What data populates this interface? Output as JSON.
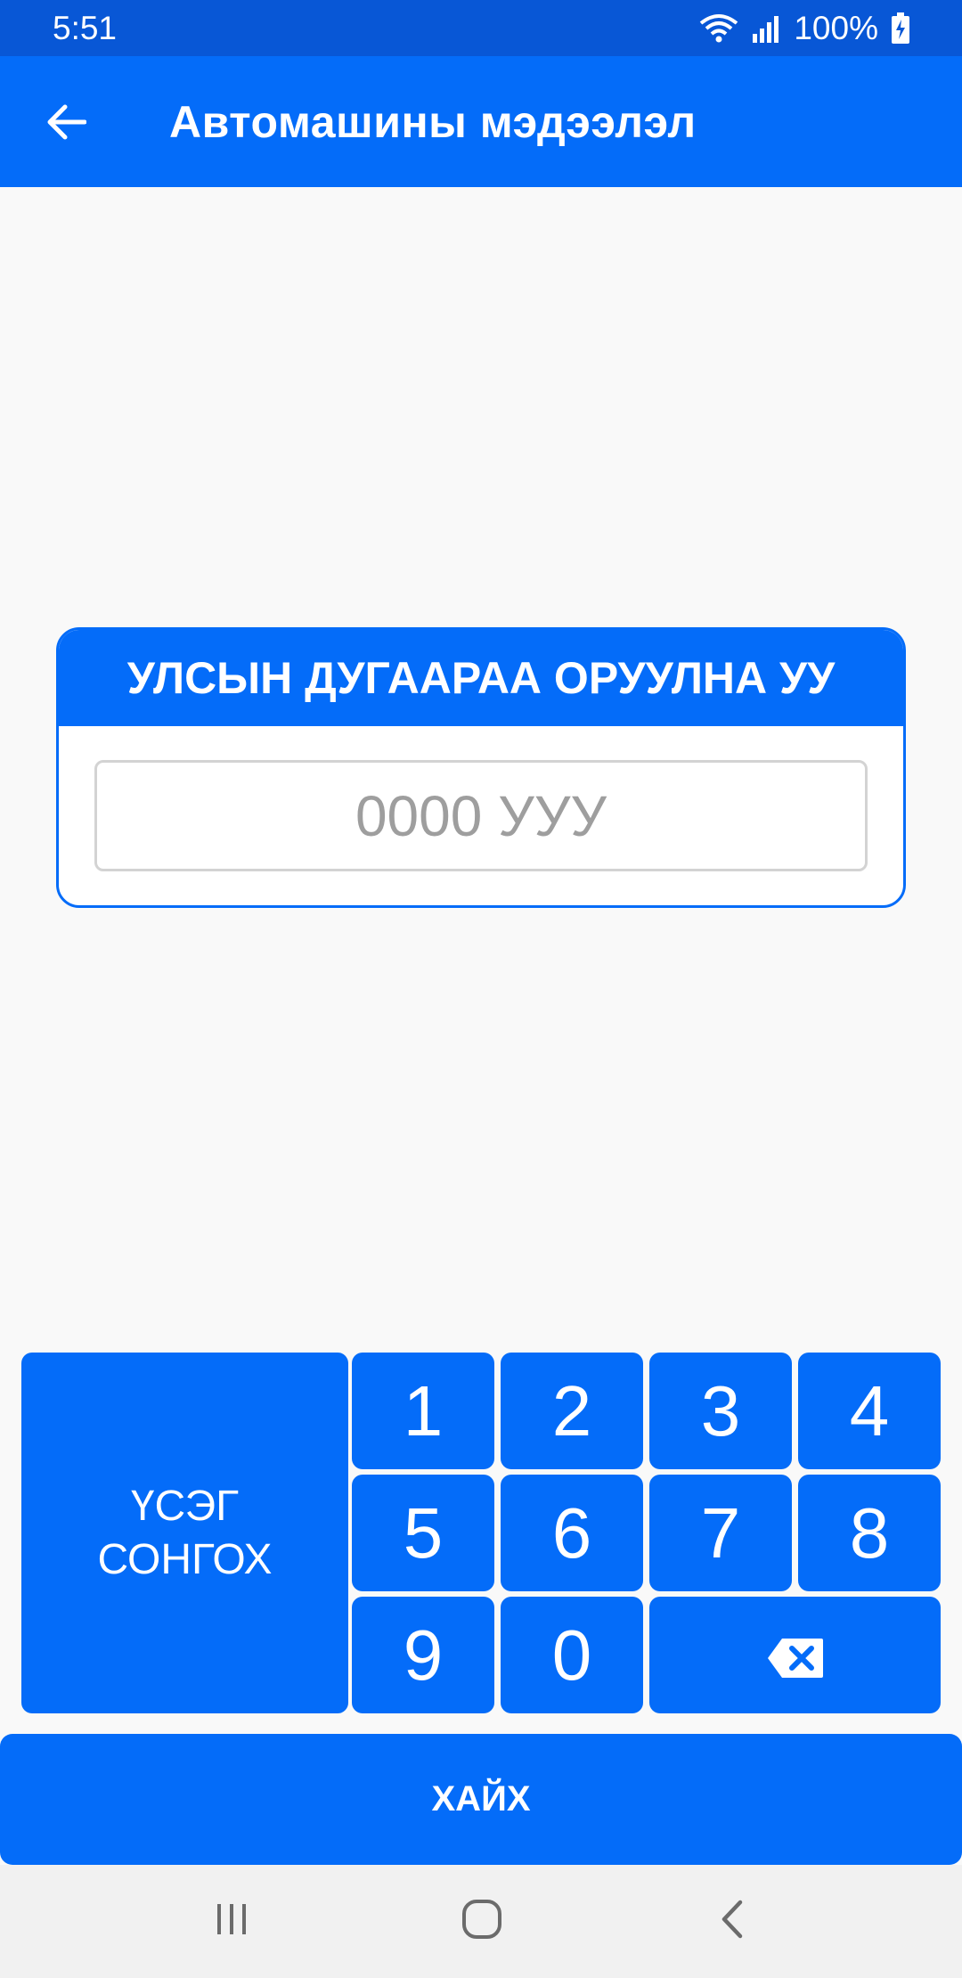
{
  "status_bar": {
    "time": "5:51",
    "battery": "100%"
  },
  "app_bar": {
    "title": "Автомашины мэдээлэл",
    "back_icon": "arrow-left-icon"
  },
  "plate_card": {
    "header": "УЛСЫН ДУГААРАА ОРУУЛНА УУ",
    "input_value": "",
    "input_placeholder": "0000 УУУ"
  },
  "keypad": {
    "letters_line1": "ҮСЭГ",
    "letters_line2": "СОНГОХ",
    "digits": [
      "1",
      "2",
      "3",
      "4",
      "5",
      "6",
      "7",
      "8",
      "9",
      "0"
    ],
    "backspace_icon": "backspace-icon"
  },
  "search_button": "ХАЙХ",
  "nav_bar": {
    "recents_icon": "recents-icon",
    "home_icon": "home-icon",
    "back_icon": "back-chevron-icon"
  },
  "colors": {
    "primary": "#046cf9",
    "status": "#0857d6",
    "background": "#f9f9f9"
  }
}
